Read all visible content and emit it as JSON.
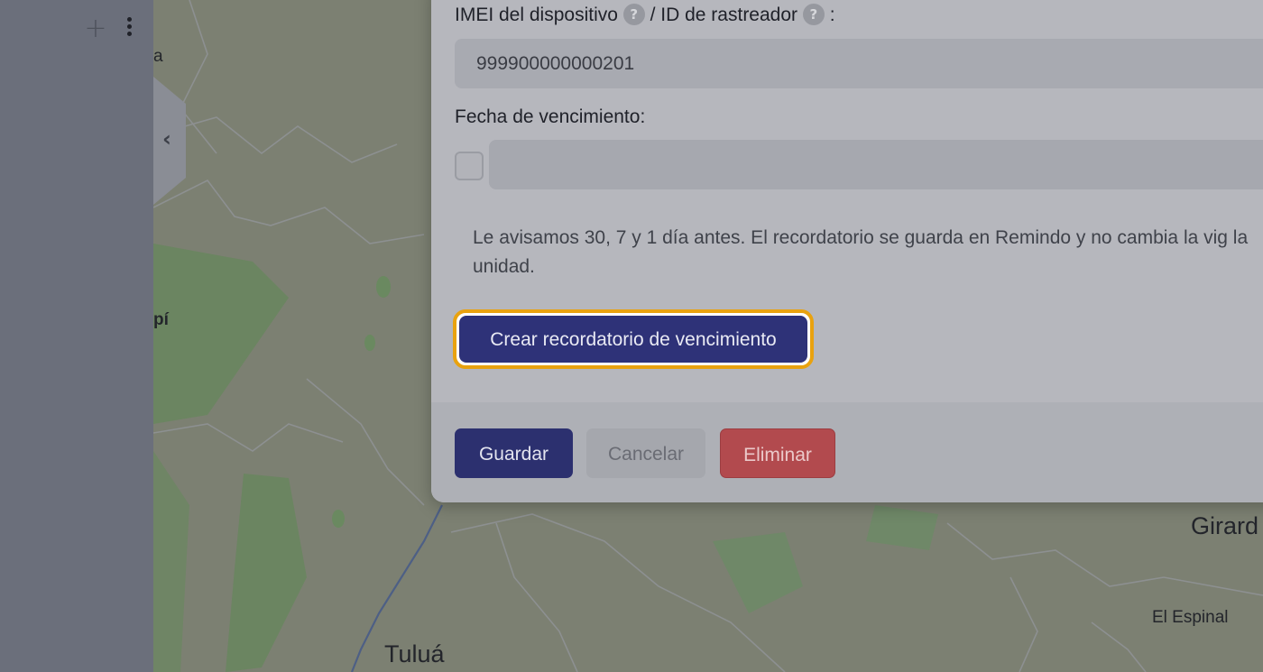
{
  "map": {
    "labels": [
      "Tuluá",
      "Girard",
      "El Espinal",
      "a",
      "pí"
    ],
    "colors": {
      "land": "#7c8072",
      "forest": "#6c8664",
      "roads": "#8e9192",
      "river": "#4c5f86"
    }
  },
  "modal": {
    "imei_label": "IMEI del dispositivo",
    "tracker_label": "/ ID de rastreador",
    "colon": ":",
    "help_glyph": "?",
    "imei_value": "999900000000201",
    "expiry_label": "Fecha de vencimiento:",
    "expiry_value": "",
    "hint_text": "Le avisamos 30, 7 y 1 día antes. El recordatorio se guarda en Remindo y no cambia la vig la unidad.",
    "create_reminder_button": "Crear recordatorio de vencimiento",
    "save_button": "Guardar",
    "cancel_button": "Cancelar",
    "delete_button": "Eliminar"
  },
  "sidebar": {
    "add_glyph": "+"
  },
  "colors": {
    "primary": "#2e3278",
    "focus_ring": "#e9a20f",
    "danger": "#b24a4e"
  }
}
